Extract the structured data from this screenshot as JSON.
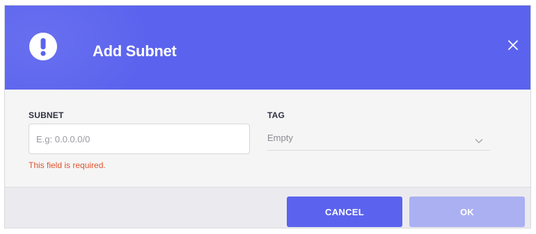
{
  "dialog": {
    "title": "Add Subnet",
    "header_color": "#5b63ee",
    "alert_icon": "exclamation-circle-icon",
    "close_icon": "close-icon"
  },
  "form": {
    "subnet": {
      "label": "SUBNET",
      "placeholder": "E.g: 0.0.0.0/0",
      "value": "",
      "error": "This field is required."
    },
    "tag": {
      "label": "TAG",
      "selected": "Empty",
      "icon": "chevron-down-icon"
    }
  },
  "footer": {
    "cancel_label": "CANCEL",
    "ok_label": "OK",
    "ok_disabled": true
  },
  "colors": {
    "accent": "#5b63ee",
    "disabled": "#aab0f1",
    "error": "#e0532f"
  }
}
